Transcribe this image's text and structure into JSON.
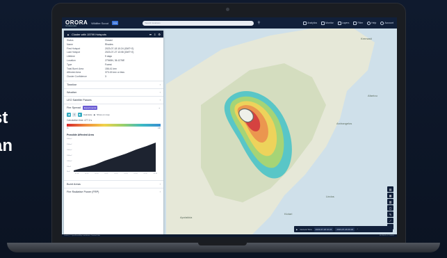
{
  "hero_text": [
    "st",
    "an"
  ],
  "app": {
    "logo": "ORORA",
    "logo_sub": "TECHNOLOGIES",
    "workspace": "Wildfire Scout",
    "badge": "Live",
    "search_placeholder": "Search locations",
    "menu": [
      {
        "label": "Analytics",
        "icon": "chart-icon"
      },
      {
        "label": "Monitor",
        "icon": "monitor-icon"
      },
      {
        "label": "Layers",
        "icon": "layers-icon"
      },
      {
        "label": "Filter",
        "icon": "filter-icon"
      },
      {
        "label": "Help",
        "icon": "help-icon"
      },
      {
        "label": "Account",
        "icon": "account-icon"
      }
    ]
  },
  "panel": {
    "title": "Cluster with 15799 Hotspots",
    "info": [
      {
        "key": "Status",
        "value": "Closed"
      },
      {
        "key": "Name",
        "value": "Rhodes"
      },
      {
        "key": "First Hotspot",
        "value": "2023-07-18 10:24 (GMT+2)"
      },
      {
        "key": "Last Hotspot",
        "value": "2023-07-27 13:08 (GMT+2)"
      },
      {
        "key": "Lifetime",
        "value": "9 days"
      },
      {
        "key": "Location",
        "value": "27945N, 36.1276E"
      },
      {
        "key": "Type",
        "value": "Forest"
      },
      {
        "key": "Total Burnt Area",
        "value": "156.41 km²"
      },
      {
        "key": "Affected Area",
        "value": "373.15 km² or less"
      },
      {
        "key": "Cluster Confidence",
        "value": "3"
      }
    ],
    "sections_top": [
      "Timeline",
      "Weather",
      "LEO Satellite Passes"
    ],
    "fire_spread": {
      "label": "Fire Spread",
      "badge": "Experimental",
      "controls": [
        "Calculate",
        "Show on map"
      ],
      "calc_text": "Calculation time: 477.2 s",
      "ramp_min": "0h",
      "ramp_max": "24h",
      "chart_title": "Possible Affected Area",
      "y_ticks": [
        "300km²",
        "250km²",
        "200km²",
        "150km²",
        "100km²",
        "50km²",
        "0km²"
      ],
      "x_ticks": [
        "07-18",
        "07-19",
        "07-20",
        "07-21",
        "07-22",
        "07-23",
        "07-24",
        "07-25",
        "07-26"
      ]
    },
    "sections_bottom": [
      "Burnt Areas",
      "Fire Radiative Power (FRP)"
    ]
  },
  "map": {
    "labels": [
      "Kremasti",
      "Archangelos",
      "Afantou",
      "Lindos",
      "Kiotari",
      "Apolakkia"
    ]
  },
  "timebar": {
    "label": "Current Time",
    "start": "2023-07-18 10:24",
    "end": "2023-07-26 09:18"
  },
  "status_strip": {
    "left": "Leaflet | © OpenStreetMap contributors, Sentinel Hub",
    "right": "36.1180 N, 27.9430 E"
  }
}
